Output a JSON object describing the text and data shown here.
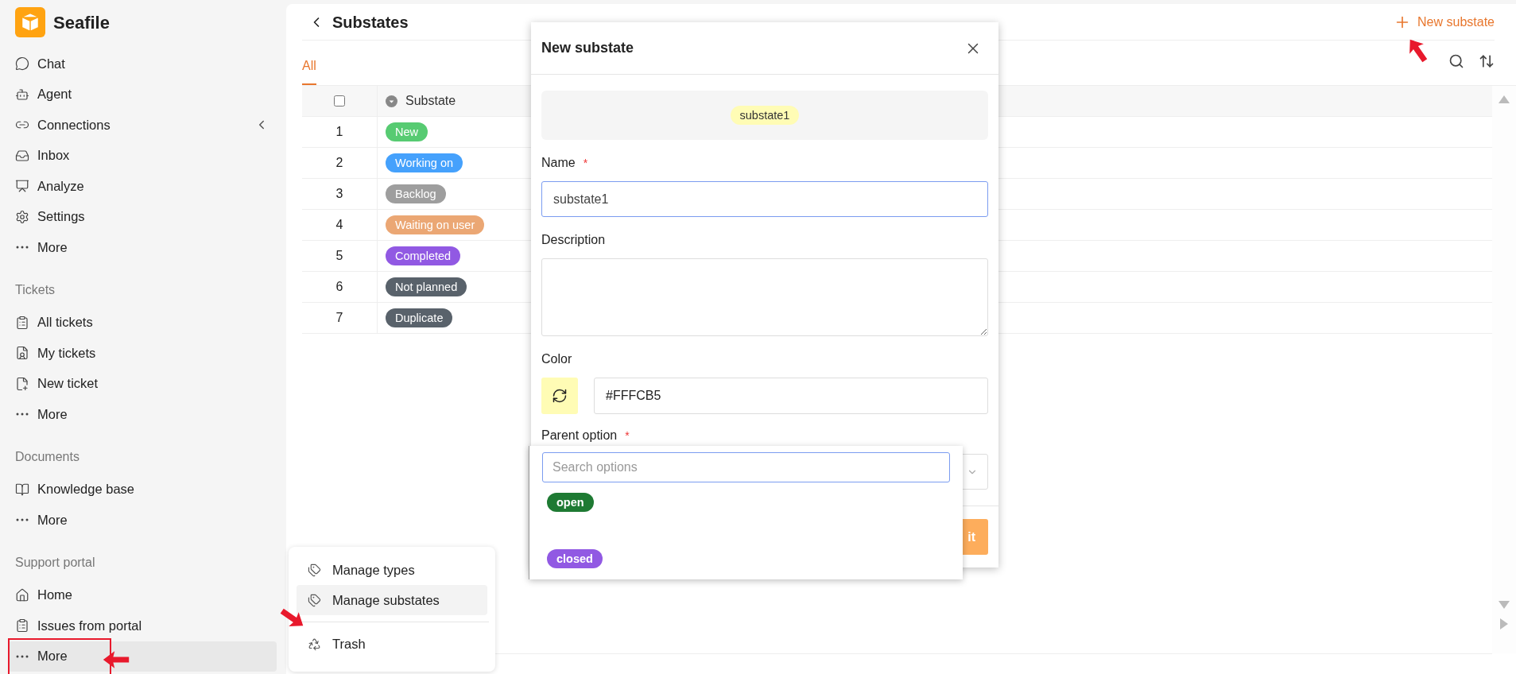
{
  "brand": {
    "name": "Seafile"
  },
  "sidebar": {
    "sections": [
      {
        "items": [
          {
            "kind": "chat",
            "label": "Chat",
            "selected": false,
            "highlighted": false
          },
          {
            "kind": "agent",
            "label": "Agent",
            "selected": false,
            "highlighted": false
          },
          {
            "kind": "connections",
            "label": "Connections",
            "selected": false,
            "highlighted": false,
            "collapse_arrow": true
          },
          {
            "kind": "inbox",
            "label": "Inbox",
            "selected": false,
            "highlighted": false
          },
          {
            "kind": "analyze",
            "label": "Analyze",
            "selected": false,
            "highlighted": false
          },
          {
            "kind": "settings",
            "label": "Settings",
            "selected": false,
            "highlighted": false
          },
          {
            "kind": "more",
            "label": "More",
            "selected": false,
            "highlighted": false
          }
        ]
      },
      {
        "title": "Tickets",
        "items": [
          {
            "kind": "list",
            "label": "All tickets",
            "selected": false,
            "highlighted": false
          },
          {
            "kind": "mine",
            "label": "My tickets",
            "selected": false,
            "highlighted": false
          },
          {
            "kind": "new",
            "label": "New ticket",
            "selected": false,
            "highlighted": false
          },
          {
            "kind": "more",
            "label": "More",
            "selected": false,
            "highlighted": false
          }
        ]
      },
      {
        "title": "Documents",
        "items": [
          {
            "kind": "book",
            "label": "Knowledge base",
            "selected": false,
            "highlighted": false
          },
          {
            "kind": "more",
            "label": "More",
            "selected": false,
            "highlighted": false
          }
        ]
      },
      {
        "title": "Support portal",
        "items": [
          {
            "kind": "home",
            "label": "Home",
            "selected": false,
            "highlighted": false
          },
          {
            "kind": "list",
            "label": "Issues from portal",
            "selected": false,
            "highlighted": false
          },
          {
            "kind": "more",
            "label": "More",
            "selected": true,
            "highlighted": true
          }
        ]
      }
    ]
  },
  "page": {
    "title": "Substates",
    "new_button": "New substate",
    "tabs": [
      {
        "label": "All",
        "selected": true
      }
    ]
  },
  "table": {
    "column_header": "Substate",
    "select_all_checked": false,
    "rows": [
      {
        "index": "1",
        "label": "New",
        "color": "#57cb72"
      },
      {
        "index": "2",
        "label": "Working on",
        "color": "#45a1fc"
      },
      {
        "index": "3",
        "label": "Backlog",
        "color": "#9e9e9e"
      },
      {
        "index": "4",
        "label": "Waiting on user",
        "color": "#eba774"
      },
      {
        "index": "5",
        "label": "Completed",
        "color": "#9159e3"
      },
      {
        "index": "6",
        "label": "Not planned",
        "color": "#59626b"
      },
      {
        "index": "7",
        "label": "Duplicate",
        "color": "#59626b"
      }
    ]
  },
  "dialog": {
    "title": "New substate",
    "preview": "substate1",
    "name_label": "Name",
    "name_mark": "*",
    "name_value": "substate1",
    "description_label": "Description",
    "color_label": "Color",
    "color_value": "#FFFCB5",
    "color": "#fffcb5",
    "parent_label": "Parent option",
    "parent_mark": "*",
    "submit": "it"
  },
  "dropdown": {
    "placeholder": "Search options",
    "options": [
      {
        "label": "open",
        "color": "#1e7a33"
      },
      {
        "label": "closed",
        "color": "#9159e3"
      }
    ]
  },
  "context_menu": {
    "items": [
      {
        "kind": "tag",
        "label": "Manage types",
        "selected": false
      },
      {
        "kind": "tag",
        "label": "Manage substates",
        "selected": true
      },
      {
        "kind": "trash",
        "label": "Trash",
        "selected": false,
        "divider_before": true
      }
    ]
  }
}
